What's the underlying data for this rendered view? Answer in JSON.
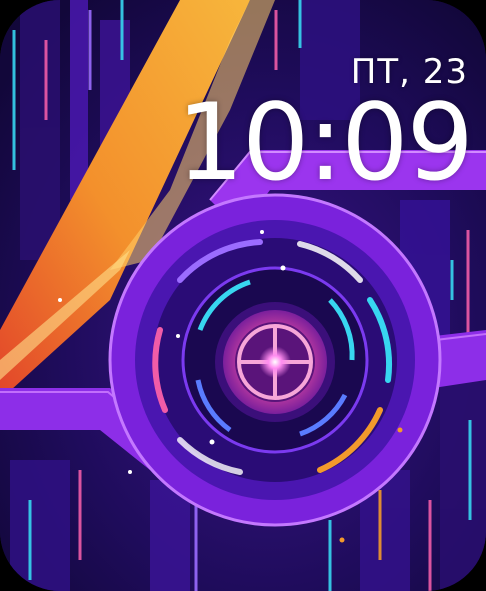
{
  "watch_face": {
    "date": "ПТ, 23",
    "time": "10:09",
    "background_art": "purple-neon-circuit-wheel"
  },
  "colors": {
    "background": "#1a0a4a",
    "accent_purple": "#9b2cf0",
    "accent_orange": "#f39a2c",
    "accent_cyan": "#38d6f0",
    "accent_pink": "#f05ca8",
    "text": "#ffffff"
  }
}
